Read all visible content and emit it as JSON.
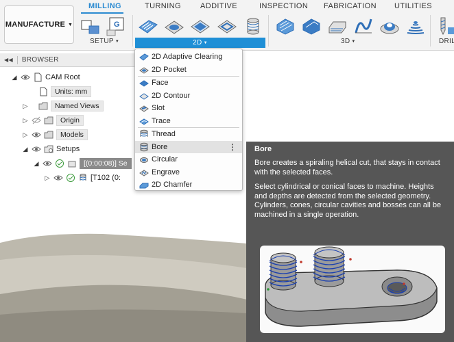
{
  "workspace": {
    "label": "MANUFACTURE"
  },
  "tabs": [
    {
      "label": "MILLING"
    },
    {
      "label": "TURNING"
    },
    {
      "label": "ADDITIVE"
    },
    {
      "label": "INSPECTION"
    },
    {
      "label": "FABRICATION"
    },
    {
      "label": "UTILITIES"
    }
  ],
  "groups": {
    "setup": "SETUP",
    "two_d": "2D",
    "three_d": "3D",
    "drill": "DRIL"
  },
  "browser": {
    "title": "BROWSER",
    "items": [
      {
        "label": "CAM Root"
      },
      {
        "label": "Units: mm"
      },
      {
        "label": "Named Views"
      },
      {
        "label": "Origin"
      },
      {
        "label": "Models"
      },
      {
        "label": "Setups"
      },
      {
        "label": "[(0:00:08)] Se"
      },
      {
        "label": "[T102 (0:"
      }
    ]
  },
  "menu": {
    "items": [
      {
        "label": "2D Adaptive Clearing"
      },
      {
        "label": "2D Pocket"
      },
      {
        "label": "Face"
      },
      {
        "label": "2D Contour"
      },
      {
        "label": "Slot"
      },
      {
        "label": "Trace"
      },
      {
        "label": "Thread"
      },
      {
        "label": "Bore"
      },
      {
        "label": "Circular"
      },
      {
        "label": "Engrave"
      },
      {
        "label": "2D Chamfer"
      }
    ],
    "more": "⋮"
  },
  "tooltip": {
    "title": "Bore",
    "p1": "Bore creates a spiraling helical cut, that stays in contact with the selected faces.",
    "p2": "Select cylindrical or conical faces to machine. Heights and depths are detected from the selected geometry. Cylinders, cones, circular cavities and bosses can all be machined in a single operation."
  },
  "colors": {
    "accent": "#1f8fd6",
    "tooltip_bg": "#565656",
    "tool_blue": "#2f6fb7"
  }
}
